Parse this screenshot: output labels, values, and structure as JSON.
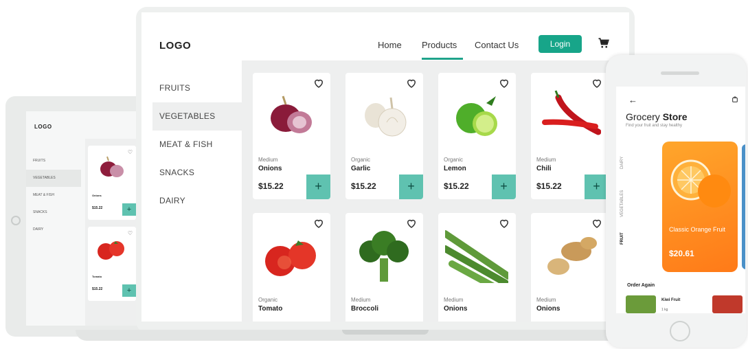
{
  "laptop": {
    "logo": "LOGO",
    "nav": {
      "home": "Home",
      "products": "Products",
      "contact": "Contact Us",
      "login": "Login"
    },
    "categories": [
      "FRUITS",
      "VEGETABLES",
      "MEAT & FISH",
      "SNACKS",
      "DAIRY"
    ],
    "active_category": "VEGETABLES",
    "products": [
      {
        "sub": "Medium",
        "name": "Onions",
        "price": "$15.22",
        "icon": "onion-image"
      },
      {
        "sub": "Organic",
        "name": "Garlic",
        "price": "$15.22",
        "icon": "garlic-image"
      },
      {
        "sub": "Organic",
        "name": "Lemon",
        "price": "$15.22",
        "icon": "lime-image"
      },
      {
        "sub": "Medium",
        "name": "Chili",
        "price": "$15.22",
        "icon": "chili-image"
      },
      {
        "sub": "Organic",
        "name": "Tomato",
        "icon": "tomato-image"
      },
      {
        "sub": "Medium",
        "name": "Broccoli",
        "icon": "broccoli-image"
      },
      {
        "sub": "Medium",
        "name": "Onions",
        "icon": "okra-image"
      },
      {
        "sub": "Medium",
        "name": "Onions",
        "icon": "ginger-image"
      }
    ],
    "add_symbol": "+",
    "accent_color": "#17a589",
    "add_button_color": "#5fc2b0"
  },
  "tablet": {
    "logo": "LOGO",
    "categories": [
      "FRUITS",
      "VEGETABLES",
      "MEAT & FISH",
      "SNACKS",
      "DAIRY"
    ],
    "products": [
      {
        "name": "Onions",
        "price": "$15.22"
      },
      {
        "name": "Tomato",
        "price": "$15.22"
      }
    ]
  },
  "phone": {
    "back": "←",
    "title_a": "Grocery ",
    "title_b": "Store",
    "subtitle": "Find your fruit and stay healthy",
    "tabs": [
      "FRUIT",
      "VEGETABLES",
      "DAIRY"
    ],
    "featured": {
      "name": "Classic Orange Fruit",
      "price": "$20.61",
      "color": "#ff8c1a"
    },
    "order_again": "Order Again",
    "order_item": {
      "name": "Kiwi Fruit",
      "sub": "1 kg"
    }
  }
}
